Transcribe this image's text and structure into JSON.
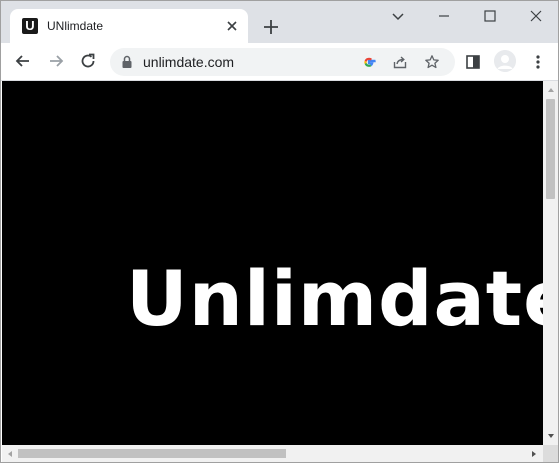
{
  "tab": {
    "favicon_letter": "U",
    "title": "UNlimdate"
  },
  "toolbar": {
    "url": "unlimdate.com"
  },
  "page": {
    "brand": "Unlimdate"
  },
  "colors": {
    "tabstrip": "#dee1e6",
    "page_background": "#000000",
    "brand_text": "#ffffff"
  }
}
